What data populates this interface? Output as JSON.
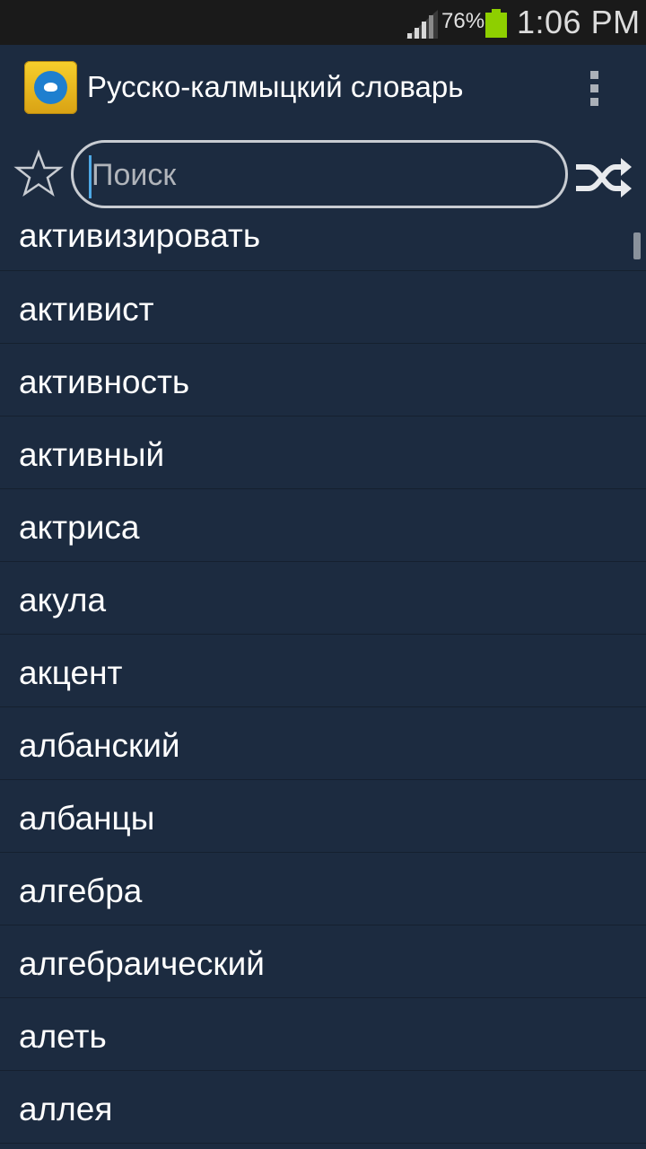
{
  "status_bar": {
    "battery_percent": "76%",
    "time": "1:06 PM",
    "battery_color": "#8ecf00",
    "icons": [
      "signal-icon",
      "battery-icon"
    ]
  },
  "action_bar": {
    "title": "Русско-калмыцкий словарь",
    "icons": [
      "app-logo-icon",
      "overflow-menu-icon"
    ]
  },
  "search": {
    "placeholder": "Поиск",
    "value": "",
    "icons": [
      "star-icon",
      "shuffle-icon"
    ]
  },
  "words": [
    "активизировать",
    "активист",
    "активность",
    "активный",
    "актриса",
    "акула",
    "акцент",
    "албанский",
    "албанцы",
    "алгебра",
    "алгебраический",
    "алеть",
    "аллея"
  ],
  "colors": {
    "background": "#1c2b40",
    "status_bar": "#1a1a1a",
    "cursor": "#4ea9e6"
  }
}
